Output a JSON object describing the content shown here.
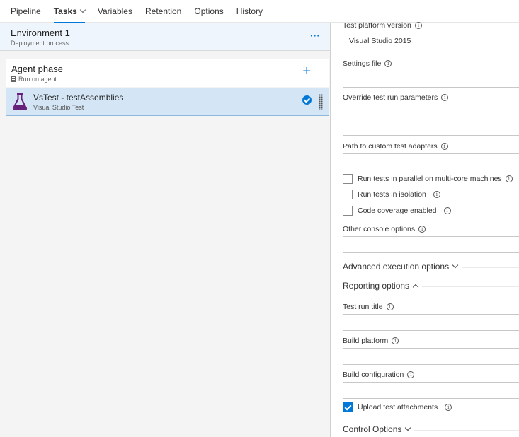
{
  "nav": {
    "tabs": [
      {
        "label": "Pipeline"
      },
      {
        "label": "Tasks"
      },
      {
        "label": "Variables"
      },
      {
        "label": "Retention"
      },
      {
        "label": "Options"
      },
      {
        "label": "History"
      }
    ],
    "active_tab": "Tasks"
  },
  "environment": {
    "title": "Environment 1",
    "subtitle": "Deployment process",
    "more_label": "···"
  },
  "phase": {
    "title": "Agent phase",
    "subtitle": "Run on agent",
    "add_label": "+"
  },
  "task": {
    "title": "VsTest - testAssemblies",
    "subtitle": "Visual Studio Test",
    "status": "enabled",
    "accent_color": "#68217a"
  },
  "form": {
    "test_platform_version": {
      "label": "Test platform version",
      "value": "Visual Studio 2015"
    },
    "settings_file": {
      "label": "Settings file",
      "value": ""
    },
    "override_params": {
      "label": "Override test run parameters",
      "value": ""
    },
    "custom_adapters": {
      "label": "Path to custom test adapters",
      "value": ""
    },
    "parallel": {
      "label": "Run tests in parallel on multi-core machines",
      "checked": false
    },
    "isolation": {
      "label": "Run tests in isolation",
      "checked": false
    },
    "coverage": {
      "label": "Code coverage enabled",
      "checked": false
    },
    "console_options": {
      "label": "Other console options",
      "value": ""
    },
    "advanced_section": {
      "label": "Advanced execution options",
      "expanded": false
    },
    "reporting_section": {
      "label": "Reporting options",
      "expanded": true
    },
    "test_run_title": {
      "label": "Test run title",
      "value": ""
    },
    "build_platform": {
      "label": "Build platform",
      "value": ""
    },
    "build_configuration": {
      "label": "Build configuration",
      "value": ""
    },
    "upload_attachments": {
      "label": "Upload test attachments",
      "checked": true
    },
    "control_section": {
      "label": "Control Options",
      "expanded": false
    }
  },
  "colors": {
    "accent": "#0078d7",
    "selected_bg": "#d4e6f6"
  }
}
